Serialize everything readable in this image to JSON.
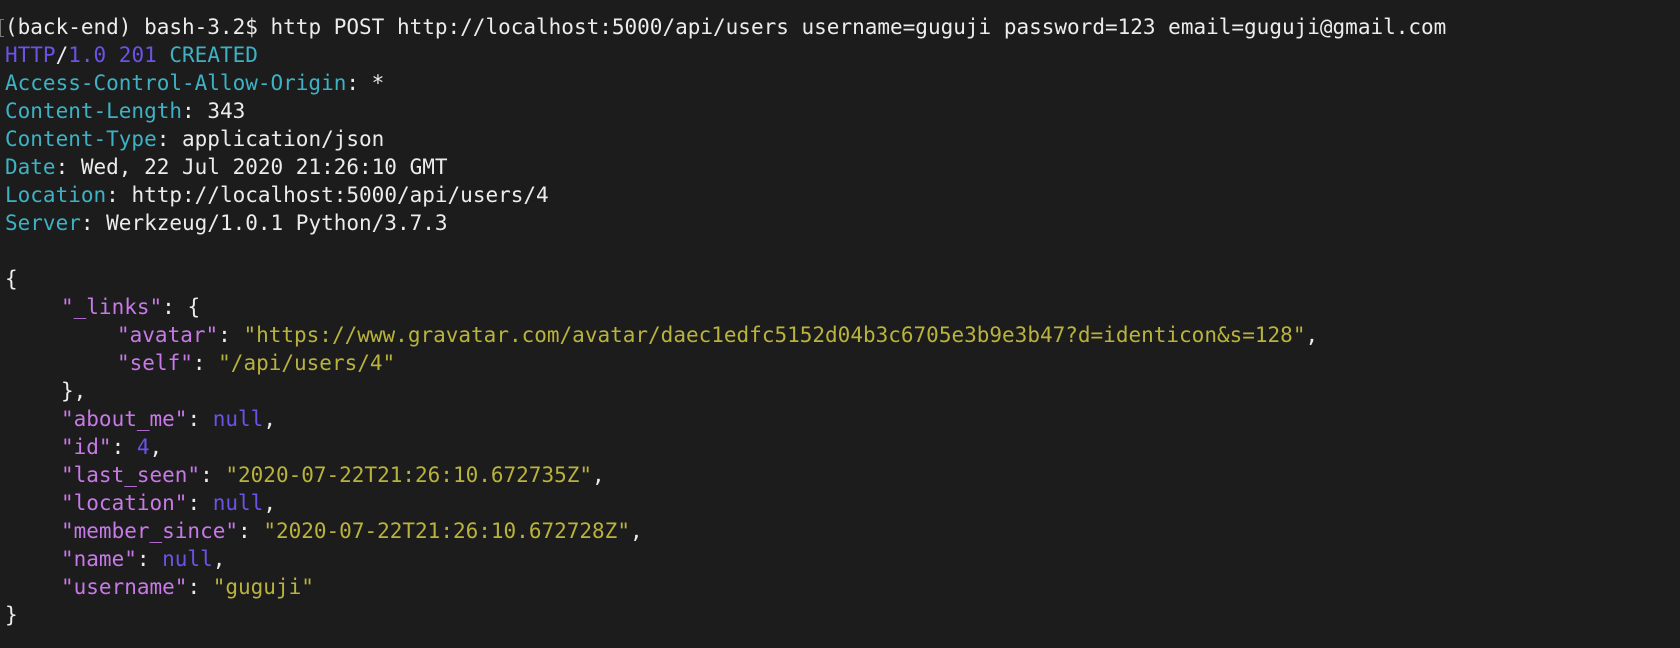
{
  "command": {
    "prompt": "(back-end) bash-3.2$ ",
    "text": "http POST http://localhost:5000/api/users username=guguji password=123 email=guguji@gmail.com"
  },
  "status": {
    "protocol": "HTTP",
    "slash": "/",
    "version": "1.0 201",
    "reason": " CREATED"
  },
  "headers": [
    {
      "name": "Access-Control-Allow-Origin",
      "value": "*"
    },
    {
      "name": "Content-Length",
      "value": "343"
    },
    {
      "name": "Content-Type",
      "value": "application/json"
    },
    {
      "name": "Date",
      "value": "Wed, 22 Jul 2020 21:26:10 GMT"
    },
    {
      "name": "Location",
      "value": "http://localhost:5000/api/users/4"
    },
    {
      "name": "Server",
      "value": "Werkzeug/1.0.1 Python/3.7.3"
    }
  ],
  "body": {
    "open": "{",
    "close": "}",
    "links_key": "\"_links\"",
    "links_open": "{",
    "links_close": "},",
    "avatar_key": "\"avatar\"",
    "avatar_value": "\"https://www.gravatar.com/avatar/daec1edfc5152d04b3c6705e3b9e3b47?d=identicon&s=128\"",
    "self_key": "\"self\"",
    "self_value": "\"/api/users/4\"",
    "about_me_key": "\"about_me\"",
    "about_me_value": "null",
    "id_key": "\"id\"",
    "id_value": "4",
    "last_seen_key": "\"last_seen\"",
    "last_seen_value": "\"2020-07-22T21:26:10.672735Z\"",
    "location_key": "\"location\"",
    "location_value": "null",
    "member_since_key": "\"member_since\"",
    "member_since_value": "\"2020-07-22T21:26:10.672728Z\"",
    "name_key": "\"name\"",
    "name_value": "null",
    "username_key": "\"username\"",
    "username_value": "\"guguji\""
  },
  "colors": {
    "background": "#1c1c1c",
    "text": "#ececec",
    "header_name": "#3db2c4",
    "keyword": "#6b53e8",
    "json_key": "#c879e8",
    "json_string": "#b9b33c"
  }
}
